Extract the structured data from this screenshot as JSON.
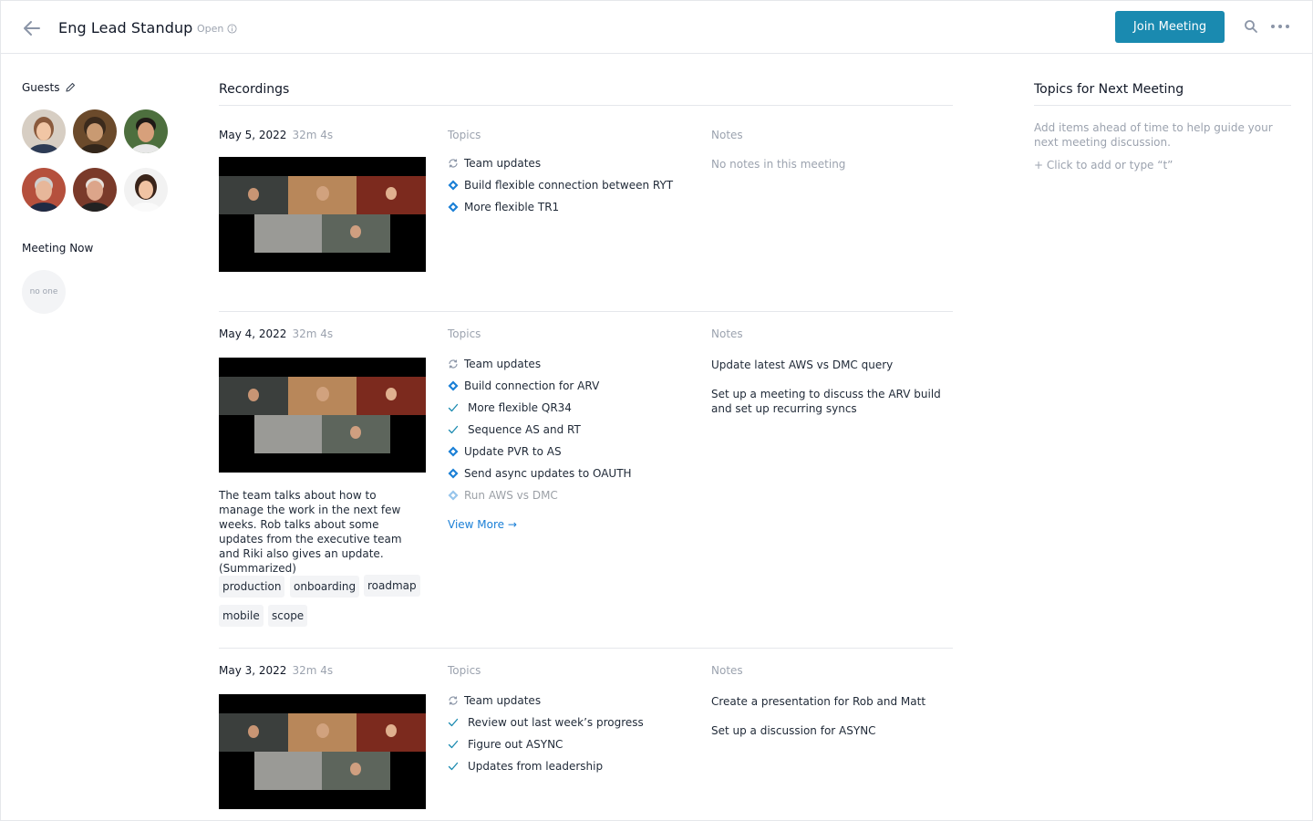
{
  "header": {
    "title": "Eng Lead Standup",
    "status": "Open",
    "join_label": "Join Meeting",
    "accent": "#1a8ab0"
  },
  "left": {
    "guests_label": "Guests",
    "meeting_now_label": "Meeting Now",
    "no_one_label": "no one",
    "guest_count": 6
  },
  "recordings": {
    "title": "Recordings",
    "topics_header": "Topics",
    "notes_header": "Notes",
    "items": [
      {
        "date": "May 5, 2022",
        "duration": "32m 4s",
        "topics": [
          {
            "icon": "sync-icon",
            "label": "Team updates"
          },
          {
            "icon": "diamond-icon",
            "label": "Build flexible connection between RYT"
          },
          {
            "icon": "diamond-icon",
            "label": "More flexible TR1"
          }
        ],
        "notes": [
          "No notes in this meeting"
        ]
      },
      {
        "date": "May 4, 2022",
        "duration": "32m 4s",
        "topics": [
          {
            "icon": "sync-icon",
            "label": "Team updates"
          },
          {
            "icon": "diamond-icon",
            "label": "Build connection for ARV"
          },
          {
            "icon": "check-icon",
            "label": "More flexible QR34"
          },
          {
            "icon": "check-icon",
            "label": "Sequence AS and RT"
          },
          {
            "icon": "diamond-icon",
            "label": "Update PVR to AS"
          },
          {
            "icon": "diamond-icon",
            "label": "Send async updates to OAUTH"
          },
          {
            "icon": "diamond-icon",
            "label": "Run AWS vs DMC"
          }
        ],
        "view_more": "View More →",
        "notes": [
          "Update latest AWS vs DMC query",
          "Set up a meeting to discuss the ARV build and set up recurring syncs"
        ],
        "summary": "The team talks about how to manage the work in the next few weeks. Rob talks about some updates from the executive team and Riki also gives an update. (Summarized)",
        "tags": [
          "production",
          "onboarding",
          "roadmap",
          "mobile",
          "scope"
        ]
      },
      {
        "date": "May 3, 2022",
        "duration": "32m 4s",
        "topics": [
          {
            "icon": "sync-icon",
            "label": "Team updates"
          },
          {
            "icon": "check-icon",
            "label": "Review out last week’s progress"
          },
          {
            "icon": "check-icon",
            "label": "Figure out ASYNC"
          },
          {
            "icon": "check-icon",
            "label": "Updates from leadership"
          }
        ],
        "notes": [
          "Create a presentation for Rob and Matt",
          "Set up a discussion for ASYNC"
        ]
      }
    ]
  },
  "next_meeting": {
    "title": "Topics for Next Meeting",
    "description": "Add items ahead of time to help guide your next meeting discussion.",
    "add_label": "+ Click to add or type “t”"
  }
}
